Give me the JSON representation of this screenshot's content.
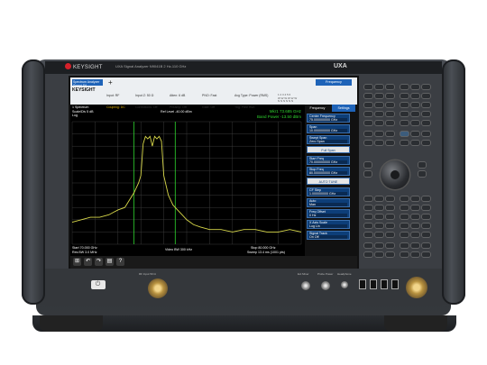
{
  "instrument": {
    "brand": "KEYSIGHT",
    "model_line": "UXA Signal Analyzer   N9041B   2 Hz-110 GHz",
    "series": "UXA"
  },
  "screen": {
    "mode_tab": "Spectrum Analyzer Swept SA",
    "header": {
      "logo": "KEYSIGHT",
      "col1": [
        "Input: RF",
        "Coupling: DC",
        "Align: Partial"
      ],
      "col2": [
        "Input Z: 50 Ω",
        "Corrections: Off",
        "Freq Ref: Int (S)",
        "NFE: Off"
      ],
      "col3": [
        "Atten: 6 dB",
        "Preamp: Off",
        "LNP: No Bypass",
        "Source: Off"
      ],
      "col4": [
        "PNO: Fast",
        "Gate: Off",
        "IF Gain: Low",
        "Sig Track: Off"
      ],
      "col5": [
        "Avg Type: Power (RMS)",
        "Trig: Free Run"
      ],
      "trace_box": "1 2 3 4 5 6\nW W W W W W\nN N N N N N"
    },
    "frequency_button": "Frequency",
    "settings_tab": "Settings",
    "spectrum_label": "1 Spectrum",
    "scale_label": "Scale/Div 5 dB",
    "scale_type": "Log",
    "ref_level": "Ref Level -40.00 dBm",
    "marker": {
      "line1": "Mkr1  73.685 GHz",
      "line2": "Band Power  -13.50 dBm"
    },
    "bottom": {
      "start": "Start 70.000 GHz",
      "res_bw": "Res BW 3.0 MHz",
      "video_bw": "Video BW 300 kHz",
      "stop": "Stop 80.000 GHz",
      "sweep": "Sweep 13.4 ms (1001 pts)"
    },
    "softkeys": [
      {
        "label": "Center Frequency",
        "value": "75.000000000 GHz"
      },
      {
        "label": "Span",
        "value": "10.000000000 GHz"
      },
      {
        "label": "Swept Span",
        "value": "Zero Span"
      },
      {
        "label": "Full Span",
        "value": ""
      },
      {
        "label": "Start Freq",
        "value": "70.000000000 GHz"
      },
      {
        "label": "Stop Freq",
        "value": "80.000000000 GHz"
      },
      {
        "label": "AUTO TUNE",
        "value": ""
      },
      {
        "label": "CF Step",
        "value": "1.000000000 GHz"
      },
      {
        "label": "Auto",
        "value": "Man"
      },
      {
        "label": "Freq Offset",
        "value": "0 Hz"
      },
      {
        "label": "X Axis Scale",
        "value": "Log  Lin"
      },
      {
        "label": "Signal Track",
        "value": "On  Off"
      }
    ],
    "taskbar_icons": [
      "windows-icon",
      "undo-icon",
      "redo-icon",
      "file-icon",
      "help-icon"
    ]
  },
  "front_panel": {
    "rf_input_label": "RF Input 50 Ω",
    "ext_mixer_label": "Ext Mixer",
    "probe_power_label": "Probe Power",
    "headphone_label": "Headphone"
  },
  "chart_data": {
    "type": "line",
    "title": "",
    "xlabel": "",
    "ylabel": "",
    "xlim": [
      70,
      80
    ],
    "ylim": [
      -90,
      -40
    ],
    "series": [
      {
        "color": "#d8d84a",
        "x": [
          70.0,
          70.4,
          70.8,
          71.2,
          71.6,
          72.0,
          72.3,
          72.5,
          72.7,
          72.9,
          73.0,
          73.1,
          73.2,
          73.3,
          73.4,
          73.5,
          73.6,
          73.7,
          73.8,
          73.9,
          74.0,
          74.1,
          74.2,
          74.3,
          74.4,
          74.6,
          74.8,
          75.0,
          75.3,
          75.6,
          76.0,
          76.5,
          77.0,
          77.5,
          78.0,
          78.5,
          79.0,
          79.5,
          80.0
        ],
        "y": [
          -81,
          -80,
          -79,
          -79,
          -78,
          -76,
          -75,
          -72,
          -69,
          -65,
          -62,
          -49,
          -46,
          -47,
          -46,
          -50,
          -46,
          -47,
          -46,
          -48,
          -62,
          -66,
          -70,
          -72,
          -74,
          -76,
          -78,
          -80,
          -82,
          -83,
          -84,
          -84,
          -85,
          -84,
          -84,
          -85,
          -85,
          -84,
          -85
        ]
      }
    ]
  }
}
